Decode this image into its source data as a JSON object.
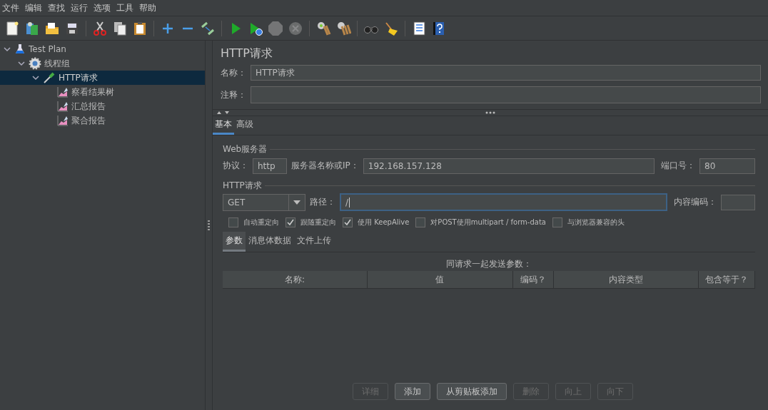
{
  "menu": [
    "文件",
    "编辑",
    "查找",
    "运行",
    "选项",
    "工具",
    "帮助"
  ],
  "toolbar": [
    {
      "kind": "new",
      "disabled": false
    },
    {
      "kind": "templates",
      "disabled": false
    },
    {
      "kind": "open",
      "disabled": false
    },
    {
      "kind": "save",
      "disabled": false
    },
    {
      "kind": "sep"
    },
    {
      "kind": "cut",
      "disabled": false
    },
    {
      "kind": "copy",
      "disabled": false
    },
    {
      "kind": "paste",
      "disabled": false
    },
    {
      "kind": "sep"
    },
    {
      "kind": "expand",
      "disabled": false
    },
    {
      "kind": "collapse",
      "disabled": false
    },
    {
      "kind": "toggle",
      "disabled": false
    },
    {
      "kind": "sep"
    },
    {
      "kind": "start",
      "disabled": false
    },
    {
      "kind": "start-no-timers",
      "disabled": false
    },
    {
      "kind": "stop",
      "disabled": true
    },
    {
      "kind": "shutdown",
      "disabled": true
    },
    {
      "kind": "sep"
    },
    {
      "kind": "clear",
      "disabled": false
    },
    {
      "kind": "clear-all",
      "disabled": false
    },
    {
      "kind": "sep"
    },
    {
      "kind": "search",
      "disabled": false
    },
    {
      "kind": "reset",
      "disabled": false
    },
    {
      "kind": "sep"
    },
    {
      "kind": "functions",
      "disabled": false
    },
    {
      "kind": "help",
      "disabled": false
    }
  ],
  "tree": [
    {
      "label": "Test Plan",
      "kind": "plan",
      "expanded": true,
      "selected": false,
      "children": [
        {
          "label": "线程组",
          "kind": "threads",
          "expanded": true,
          "selected": false,
          "children": [
            {
              "label": "HTTP请求",
              "kind": "sampler",
              "expanded": true,
              "selected": true,
              "children": [
                {
                  "label": "察看结果树",
                  "kind": "listener",
                  "selected": false
                },
                {
                  "label": "汇总报告",
                  "kind": "listener",
                  "selected": false
                },
                {
                  "label": "聚合报告",
                  "kind": "listener",
                  "selected": false
                }
              ]
            }
          ]
        }
      ]
    }
  ],
  "panel": {
    "title": "HTTP请求",
    "name": {
      "label": "名称：",
      "value": "HTTP请求"
    },
    "comment": {
      "label": "注释："
    },
    "tabs": [
      {
        "label": "基本",
        "selected": true
      },
      {
        "label": "高级",
        "selected": false
      }
    ],
    "web_server": {
      "title": "Web服务器",
      "protocol_label": "协议：",
      "protocol": "http",
      "server_label": "服务器名称或IP：",
      "server": "192.168.157.128",
      "port_label": "端口号：",
      "port": "80"
    },
    "request": {
      "title": "HTTP请求",
      "method": "GET",
      "path_label": "路径：",
      "path": "/",
      "encoding_label": "内容编码："
    },
    "options": [
      {
        "label": "自动重定向",
        "checked": false
      },
      {
        "label": "跟随重定向",
        "checked": true
      },
      {
        "label": "使用 KeepAlive",
        "checked": true
      },
      {
        "label": "对POST使用multipart / form-data",
        "checked": false
      },
      {
        "label": "与浏览器兼容的头",
        "checked": false
      }
    ],
    "sub_tabs": [
      {
        "label": "参数",
        "selected": true
      },
      {
        "label": "消息体数据",
        "selected": false
      },
      {
        "label": "文件上传",
        "selected": false
      }
    ],
    "params_caption": "同请求一起发送参数：",
    "table": {
      "columns": [
        "名称:",
        "值",
        "编码？",
        "内容类型",
        "包含等于？"
      ]
    },
    "buttons": [
      {
        "label": "详细",
        "disabled": true
      },
      {
        "label": "添加",
        "disabled": false
      },
      {
        "label": "从剪贴板添加",
        "disabled": false
      },
      {
        "label": "删除",
        "disabled": true
      },
      {
        "label": "向上",
        "disabled": true
      },
      {
        "label": "向下",
        "disabled": true
      }
    ]
  }
}
